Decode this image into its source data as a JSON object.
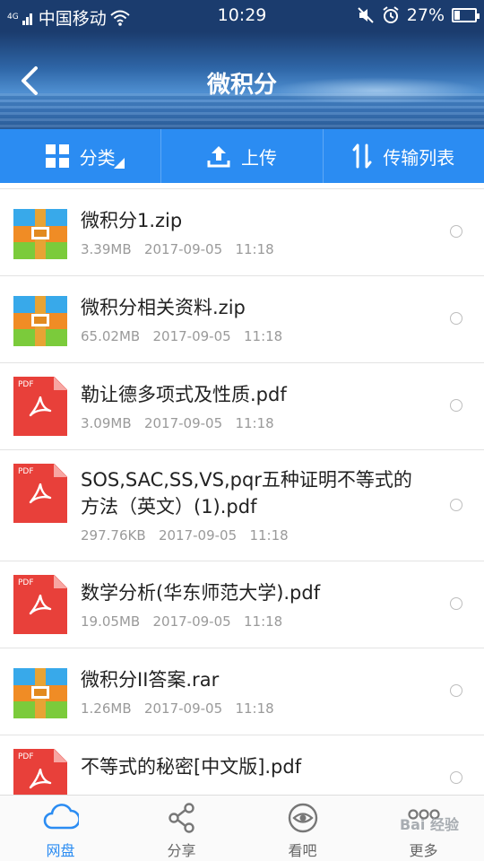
{
  "status_bar": {
    "network_type": "4G",
    "carrier": "中国移动",
    "time": "10:29",
    "battery_percent": "27%",
    "battery_level": 0.27,
    "icons": [
      "signal-icon",
      "wifi-icon",
      "mute-icon",
      "alarm-icon",
      "battery-icon"
    ]
  },
  "header": {
    "title": "微积分",
    "back_icon": "chevron-left-icon"
  },
  "toolbar": {
    "items": [
      {
        "label": "分类",
        "icon": "grid-icon"
      },
      {
        "label": "上传",
        "icon": "upload-icon"
      },
      {
        "label": "传输列表",
        "icon": "transfer-icon"
      }
    ]
  },
  "files": [
    {
      "name": "微积分1.zip",
      "size": "3.39MB",
      "date": "2017-09-05",
      "time": "11:18",
      "type": "zip"
    },
    {
      "name": "微积分相关资料.zip",
      "size": "65.02MB",
      "date": "2017-09-05",
      "time": "11:18",
      "type": "zip"
    },
    {
      "name": "勒让德多项式及性质.pdf",
      "size": "3.09MB",
      "date": "2017-09-05",
      "time": "11:18",
      "type": "pdf"
    },
    {
      "name": "SOS,SAC,SS,VS,pqr五种证明不等式的方法（英文）(1).pdf",
      "size": "297.76KB",
      "date": "2017-09-05",
      "time": "11:18",
      "type": "pdf"
    },
    {
      "name": "数学分析(华东师范大学).pdf",
      "size": "19.05MB",
      "date": "2017-09-05",
      "time": "11:18",
      "type": "pdf"
    },
    {
      "name": "微积分II答案.rar",
      "size": "1.26MB",
      "date": "2017-09-05",
      "time": "11:18",
      "type": "zip"
    },
    {
      "name": "不等式的秘密[中文版].pdf",
      "size": "",
      "date": "",
      "time": "",
      "type": "pdf"
    }
  ],
  "pdf_badge": "PDF",
  "tabbar": {
    "tabs": [
      {
        "label": "网盘",
        "icon": "cloud-icon",
        "active": true
      },
      {
        "label": "分享",
        "icon": "share-icon",
        "active": false
      },
      {
        "label": "看吧",
        "icon": "eye-icon",
        "active": false
      },
      {
        "label": "更多",
        "icon": "more-icon",
        "active": false
      }
    ]
  },
  "watermark": "Bai 经验"
}
